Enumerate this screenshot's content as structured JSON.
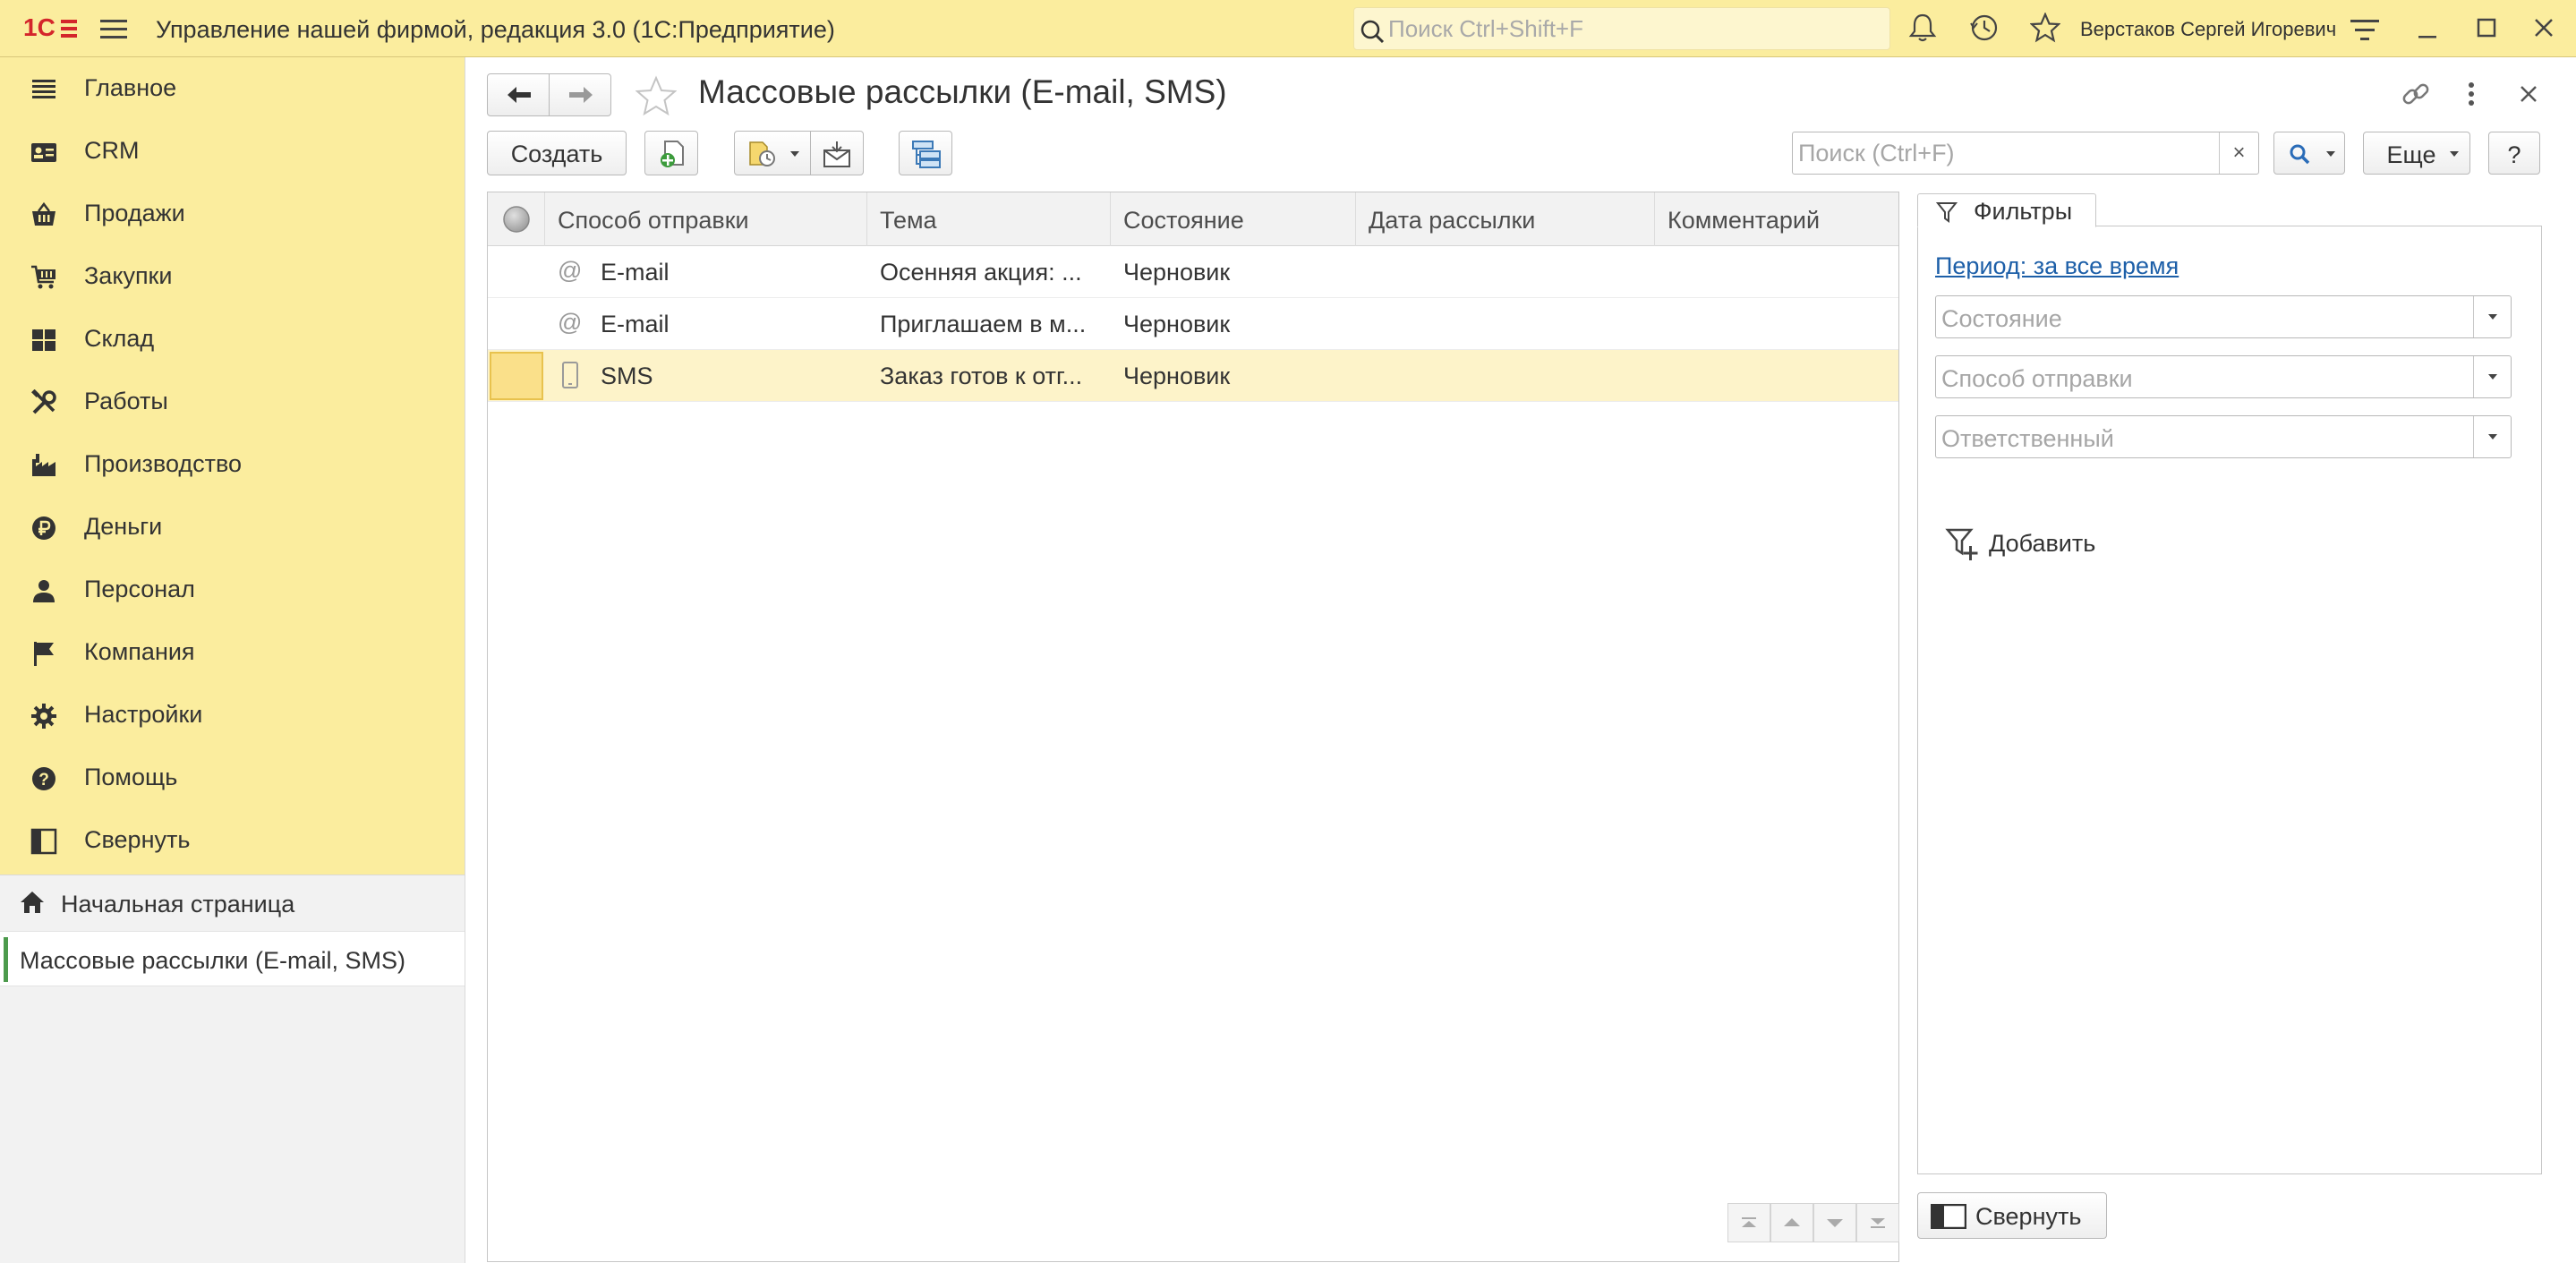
{
  "titlebar": {
    "app_title": "Управление нашей фирмой, редакция 3.0  (1С:Предприятие)",
    "search_placeholder": "Поиск Ctrl+Shift+F",
    "user_name": "Верстаков Сергей Игоревич"
  },
  "sidebar": {
    "items": [
      {
        "label": "Главное",
        "icon": "menu-lines-icon"
      },
      {
        "label": "CRM",
        "icon": "crm-card-icon"
      },
      {
        "label": "Продажи",
        "icon": "basket-icon"
      },
      {
        "label": "Закупки",
        "icon": "cart-icon"
      },
      {
        "label": "Склад",
        "icon": "warehouse-grid-icon"
      },
      {
        "label": "Работы",
        "icon": "tools-icon"
      },
      {
        "label": "Производство",
        "icon": "factory-icon"
      },
      {
        "label": "Деньги",
        "icon": "ruble-icon"
      },
      {
        "label": "Персонал",
        "icon": "person-icon"
      },
      {
        "label": "Компания",
        "icon": "flag-icon"
      },
      {
        "label": "Настройки",
        "icon": "gear-icon"
      },
      {
        "label": "Помощь",
        "icon": "help-icon"
      },
      {
        "label": "Свернуть",
        "icon": "collapse-panel-icon"
      }
    ],
    "home_label": "Начальная страница",
    "open_window_label": "Массовые рассылки (E-mail, SMS)"
  },
  "form": {
    "title": "Массовые рассылки (E-mail, SMS)",
    "create_label": "Создать",
    "list_search_placeholder": "Поиск (Ctrl+F)",
    "clear_symbol": "×",
    "more_label": "Еще",
    "help_label": "?"
  },
  "table": {
    "columns": [
      "Способ отправки",
      "Тема",
      "Состояние",
      "Дата рассылки",
      "Комментарий"
    ],
    "rows": [
      {
        "icon": "@",
        "method": "E-mail",
        "subject": "Осенняя акция: ...",
        "status": "Черновик",
        "date": "",
        "comment": ""
      },
      {
        "icon": "@",
        "method": "E-mail",
        "subject": "Приглашаем в м...",
        "status": "Черновик",
        "date": "",
        "comment": ""
      },
      {
        "icon": "phone",
        "method": "SMS",
        "subject": "Заказ готов к отг...",
        "status": "Черновик",
        "date": "",
        "comment": ""
      }
    ],
    "selected_row": 2
  },
  "filters": {
    "tab_label": "Фильтры",
    "period_link": "Период: за все время",
    "fields": [
      "Состояние",
      "Способ отправки",
      "Ответственный"
    ],
    "add_label": "Добавить",
    "collapse_label": "Свернуть"
  },
  "colors": {
    "panel_yellow": "#fbed9e",
    "selected_row": "#fdf3c9",
    "link_blue": "#1d5fa8",
    "active_marker_green": "#4c9a4c"
  }
}
